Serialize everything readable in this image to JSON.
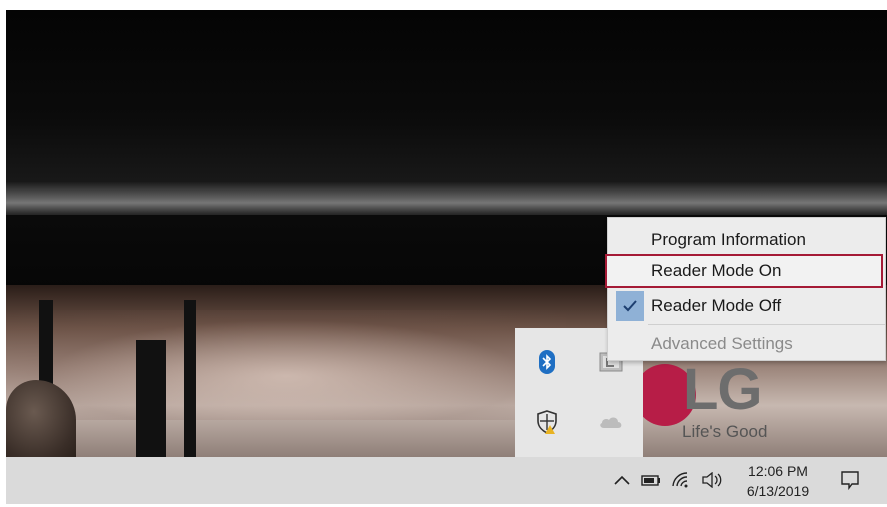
{
  "context_menu": {
    "items": [
      {
        "label": "Program Information",
        "enabled": true,
        "checked": false
      },
      {
        "label": "Reader Mode On",
        "enabled": true,
        "checked": false,
        "highlighted": true
      },
      {
        "label": "Reader Mode Off",
        "enabled": true,
        "checked": true
      },
      {
        "label": "Advanced Settings",
        "enabled": false,
        "checked": false
      }
    ]
  },
  "tray_overflow": {
    "icons": [
      "bluetooth-icon",
      "reader-mode-tray-icon",
      "windows-security-icon",
      "onedrive-icon"
    ]
  },
  "wallpaper": {
    "logo_text": "LG",
    "tagline": "Life's Good"
  },
  "taskbar": {
    "clock_time": "12:06 PM",
    "clock_date": "6/13/2019",
    "icons": [
      "show-hidden-icons-chevron-icon",
      "battery-icon",
      "wifi-icon",
      "volume-icon",
      "action-center-icon"
    ]
  },
  "colors": {
    "highlight_border": "#a51a36",
    "check_background": "#8fb1d6",
    "lg_red": "#b71d47",
    "taskbar_bg": "#dadada",
    "bluetooth_blue": "#1f6fc3"
  }
}
